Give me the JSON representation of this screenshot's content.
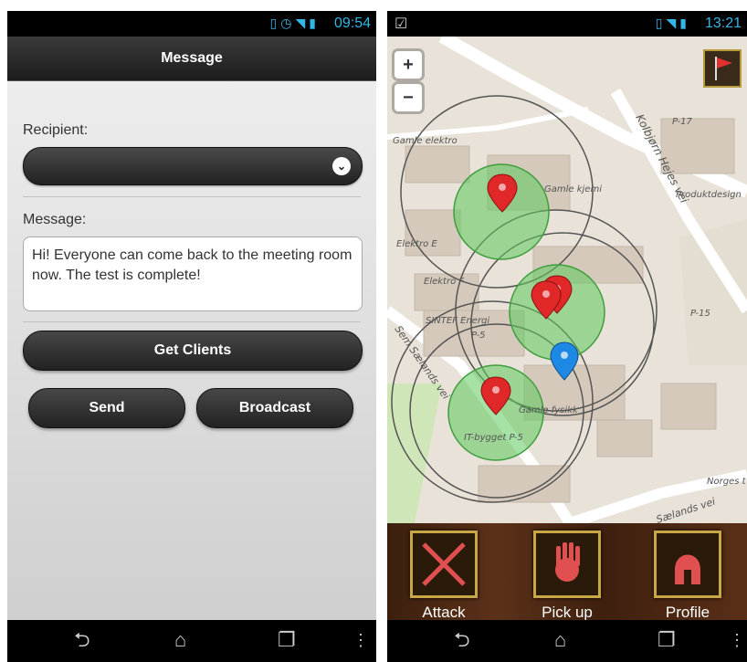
{
  "phone1": {
    "status": {
      "time": "09:54"
    },
    "title": "Message",
    "recipient_label": "Recipient:",
    "recipient_value": "",
    "message_label": "Message:",
    "message_text": "Hi! Everyone can come back to the meeting room now. The test is complete!",
    "get_clients_label": "Get Clients",
    "send_label": "Send",
    "broadcast_label": "Broadcast"
  },
  "phone2": {
    "status": {
      "time": "13:21"
    },
    "zoom_in": "+",
    "zoom_out": "−",
    "map_labels": {
      "gamle_elektro": "Gamle elektro",
      "gamle_kjemi": "Gamle kjemi",
      "kolbjorn": "Kolbjørn Hejes vei",
      "produktdesign": "Produktdesign",
      "elektro_e": "Elektro E",
      "elektro_f": "Elektro F",
      "sintef": "SINTEF Energi",
      "p5a": "P-5",
      "sem_saelands": "Sem Sælands vei",
      "gamle_fysikk": "Gamle fysikk",
      "it_bygget": "IT-bygget P-5",
      "p15": "P-15",
      "p17": "P-17",
      "norges": "Norges t",
      "saelands_vei": "Sælands vei"
    },
    "actions": [
      {
        "label": "Attack",
        "icon": "crossed-swords-icon"
      },
      {
        "label": "Pick up",
        "icon": "hand-icon"
      },
      {
        "label": "Profile",
        "icon": "helmet-icon"
      }
    ]
  },
  "colors": {
    "status_blue": "#33b5e5",
    "button_dark": "#2a2a2a",
    "circle_green": "#5cc85c",
    "marker_red": "#e02828",
    "marker_blue": "#1e88e5"
  }
}
